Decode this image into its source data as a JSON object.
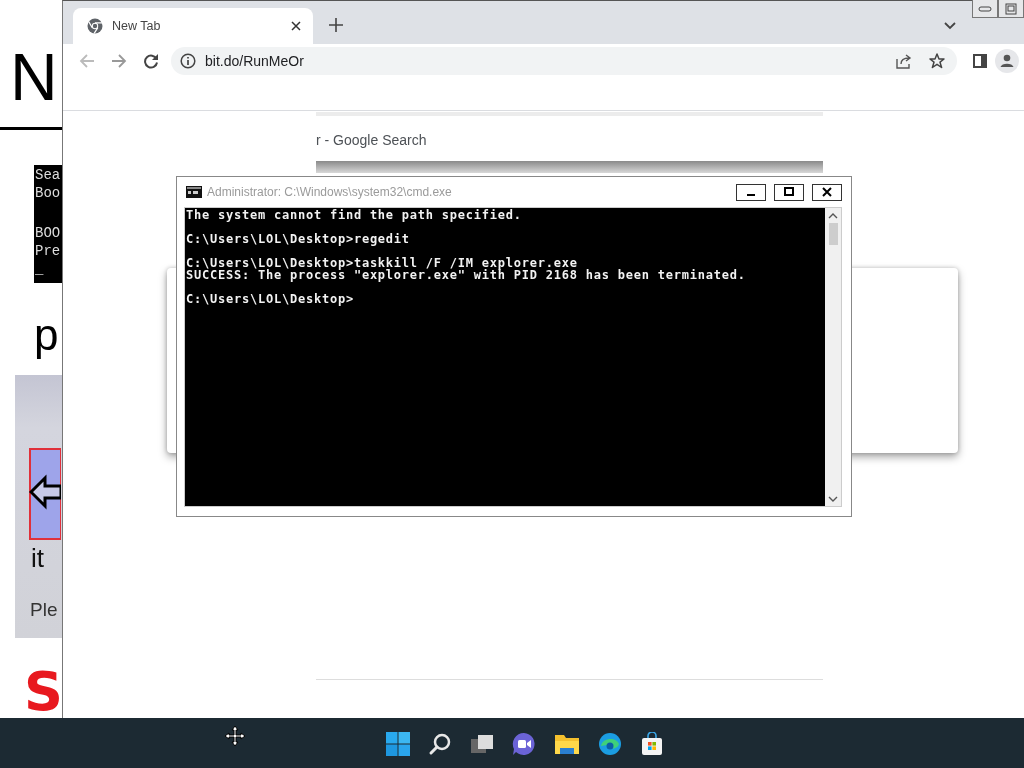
{
  "background_window": {
    "heading": "N",
    "console_blocks": [
      [
        "Sea",
        "Boo"
      ],
      [
        "BOO",
        "Pre",
        "_"
      ]
    ],
    "subheading": "p",
    "panel_text": [
      "it",
      "Ple"
    ],
    "red_letter": "S"
  },
  "browser": {
    "tabs": [
      {
        "title": "New Tab",
        "selected": true
      }
    ],
    "address": "bit.do/RunMeOr",
    "page": {
      "result_title": "r - Google Search"
    }
  },
  "console_window": {
    "title": "Administrator: C:\\Windows\\system32\\cmd.exe",
    "blocks": [
      [
        "The system cannot find the path specified."
      ],
      [
        "C:\\Users\\LOL\\Desktop>regedit"
      ],
      [
        "C:\\Users\\LOL\\Desktop>taskkill /F /IM explorer.exe",
        "SUCCESS: The process \"explorer.exe\" with PID 2168 has been terminated."
      ],
      [
        "C:\\Users\\LOL\\Desktop>"
      ]
    ]
  }
}
